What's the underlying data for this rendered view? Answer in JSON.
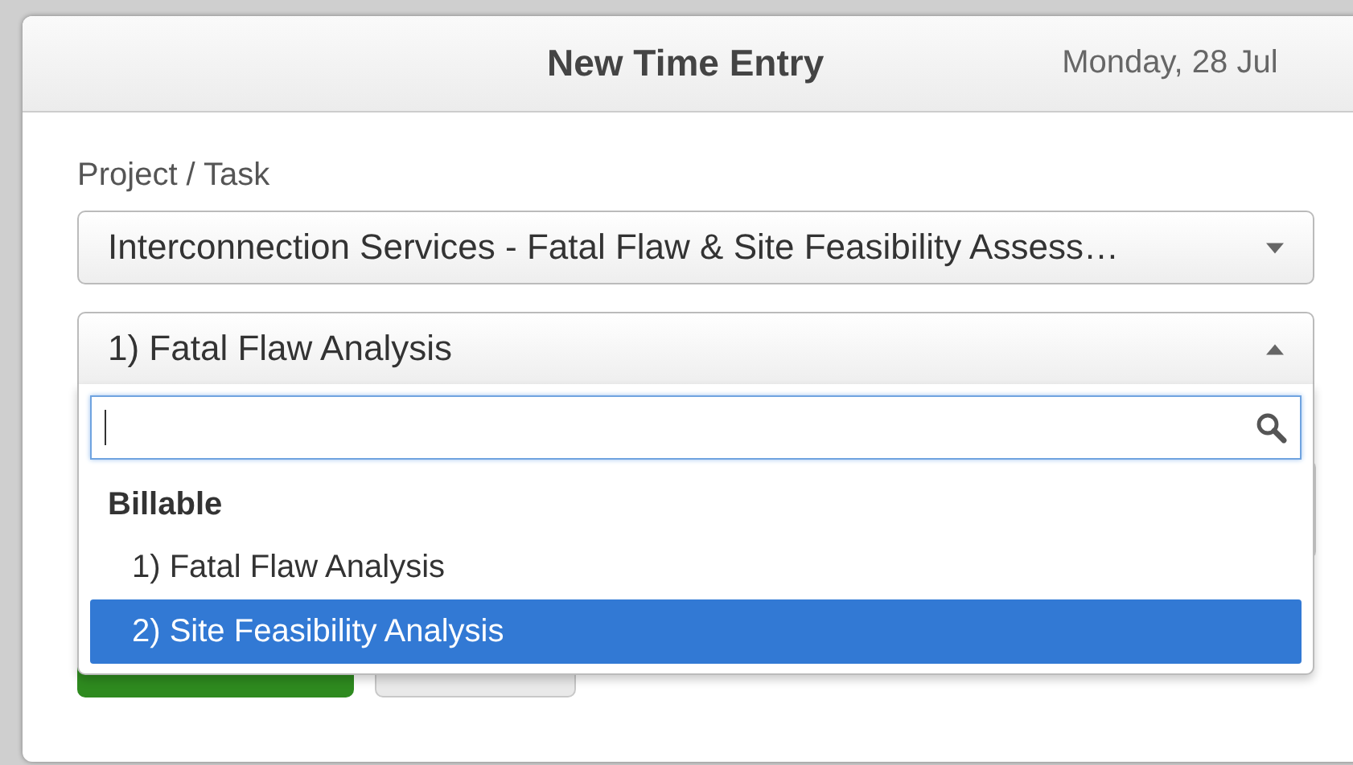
{
  "dialog": {
    "title": "New Time Entry",
    "date": "Monday, 28 Jul"
  },
  "project_label": "Project / Task",
  "project_select": {
    "value": "Interconnection Services - Fatal Flaw & Site Feasibility Assess…",
    "expanded": false
  },
  "task_select": {
    "value": "1) Fatal Flaw Analysis",
    "expanded": true,
    "groups": [
      {
        "label": "Billable",
        "options": [
          {
            "label": "1) Fatal Flaw Analysis",
            "selected": false
          },
          {
            "label": "2) Site Feasibility Analysis",
            "selected": true
          }
        ]
      }
    ]
  }
}
